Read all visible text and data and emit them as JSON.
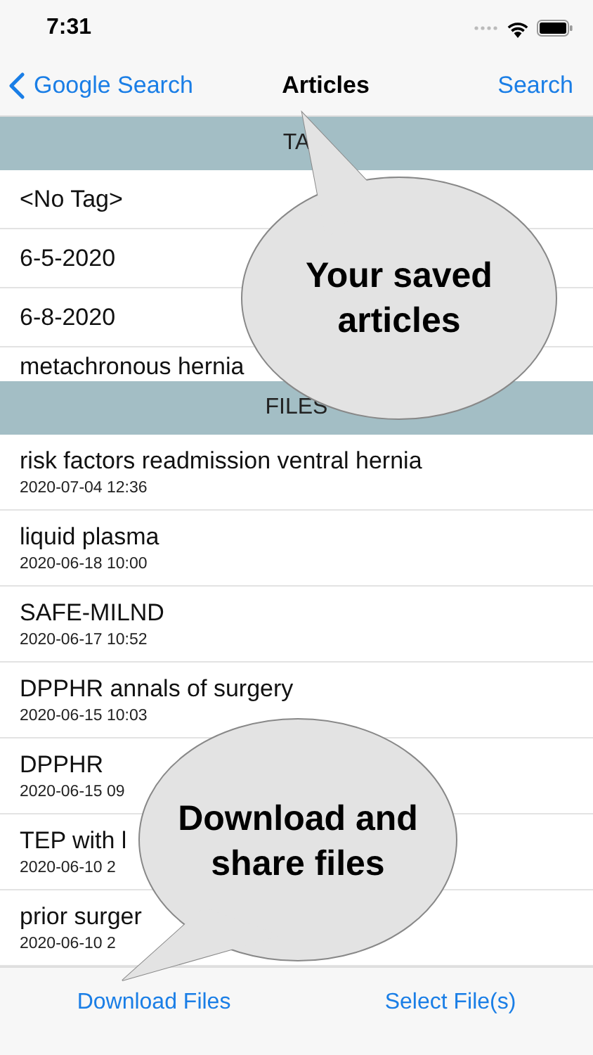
{
  "status_bar": {
    "time": "7:31"
  },
  "nav": {
    "back": "Google Search",
    "title": "Articles",
    "action": "Search"
  },
  "tags": {
    "header": "TA",
    "items": [
      "<No Tag>",
      "6-5-2020",
      "6-8-2020",
      "metachronous hernia"
    ]
  },
  "files": {
    "header": "FILES",
    "items": [
      {
        "name": "risk factors readmission ventral hernia",
        "date": "2020-07-04 12:36"
      },
      {
        "name": "liquid plasma",
        "date": "2020-06-18 10:00"
      },
      {
        "name": "SAFE-MILND",
        "date": "2020-06-17 10:52"
      },
      {
        "name": "DPPHR annals of surgery",
        "date": "2020-06-15 10:03"
      },
      {
        "name": "DPPHR",
        "date": "2020-06-15 09"
      },
      {
        "name": "TEP with l",
        "date": "2020-06-10 2"
      },
      {
        "name": "prior surger",
        "date": "2020-06-10 2"
      }
    ]
  },
  "toolbar": [
    "Download Files",
    "Select File(s)"
  ],
  "callouts": [
    "Your saved articles",
    "Download and share files"
  ]
}
